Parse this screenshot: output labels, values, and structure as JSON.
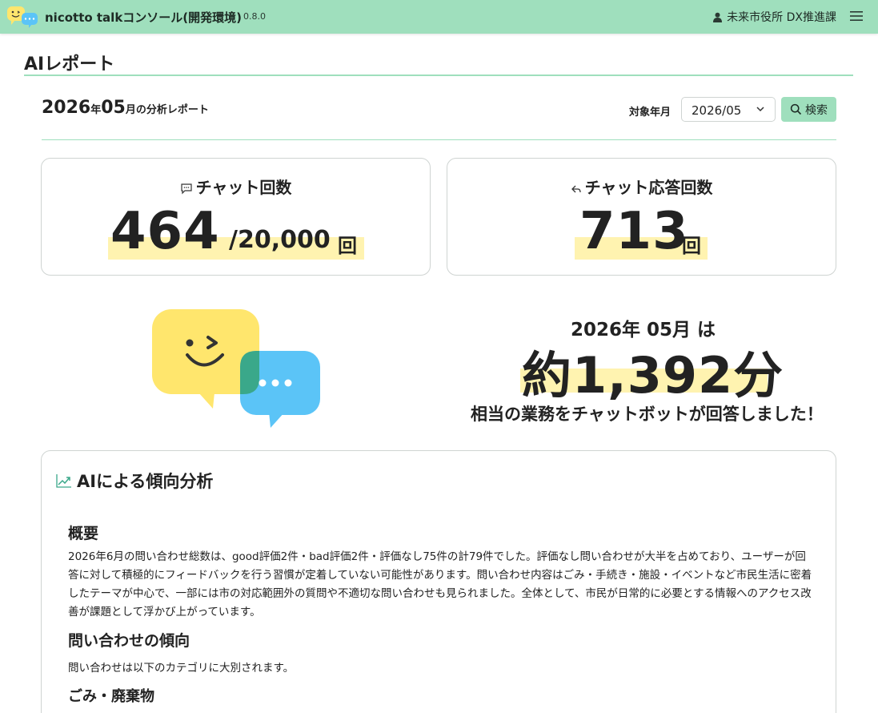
{
  "header": {
    "app_title": "nicotto talkコンソール(開発環境)",
    "version": "0.8.0",
    "user_label": "未来市役所 DX推進課",
    "colors": {
      "bar": "#9fdfbd",
      "highlight": "#fff3b0"
    }
  },
  "page": {
    "title": "AIレポート"
  },
  "report": {
    "year": "2026",
    "year_suffix": "年",
    "month": "05",
    "month_suffix": "月の分析レポート"
  },
  "filter": {
    "label": "対象年月",
    "selected": "2026/05",
    "search_label": "検索"
  },
  "stats": {
    "chat_count": {
      "label": "チャット回数",
      "value": "464",
      "limit": "/20,000",
      "unit": "回",
      "icon": "chat-bubble-icon"
    },
    "reply_count": {
      "label": "チャット応答回数",
      "value": "713",
      "unit": "回",
      "icon": "reply-icon"
    }
  },
  "savings": {
    "period": "2026年 05月 は",
    "minutes": "約1,392分",
    "description": "相当の業務をチャットボットが回答しました！"
  },
  "analysis": {
    "title": "AIによる傾向分析",
    "overview_heading": "概要",
    "overview_text": "2026年6月の問い合わせ総数は、good評価2件・bad評価2件・評価なし75件の計79件でした。評価なし問い合わせが大半を占めており、ユーザーが回答に対して積極的にフィードバックを行う習慣が定着していない可能性があります。問い合わせ内容はごみ・手続き・施設・イベントなど市民生活に密着したテーマが中心で、一部には市の対応範囲外の質問や不適切な問い合わせも見られました。全体として、市民が日常的に必要とする情報へのアクセス改善が課題として浮かび上がっています。",
    "trend_heading": "問い合わせの傾向",
    "trend_text": "問い合わせは以下のカテゴリに大別されます。",
    "category_heading": "ごみ・廃棄物"
  }
}
